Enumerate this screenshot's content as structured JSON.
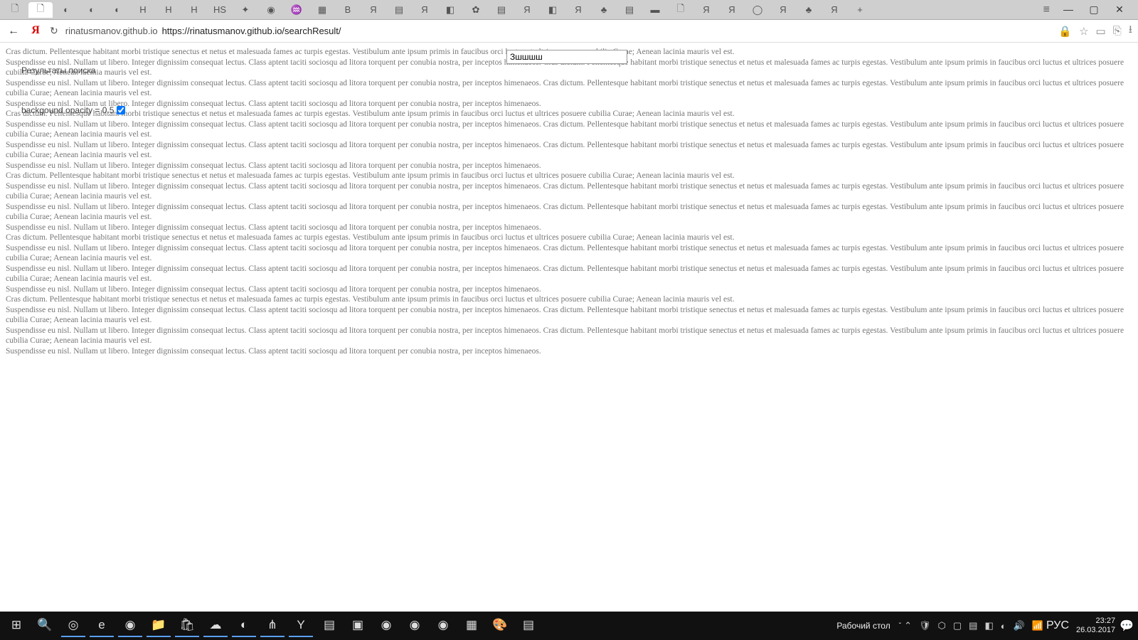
{
  "browser": {
    "url_host": "rinatusmanov.github.io",
    "url_full": "https://rinatusmanov.github.io/searchResult/",
    "tabs": [
      "🗋",
      "🗋",
      "◐",
      "◐",
      "◐",
      "H",
      "H",
      "H",
      "HS",
      "✦",
      "◉",
      "♒",
      "▦",
      "B",
      "Я",
      "▤",
      "Я",
      "◧",
      "✿",
      "▤",
      "Я",
      "◧",
      "Я",
      "♣",
      "▤",
      "▬",
      "🗋",
      "Я",
      "Я",
      "◯",
      "Я",
      "♣",
      "Я"
    ],
    "new_tab": "+",
    "menu_icon": "≡",
    "win_min": "—",
    "win_max": "▢",
    "win_close": "✕",
    "back": "←",
    "reload": "↻",
    "ya": "Я",
    "lock": "🔒",
    "star": "☆",
    "panel": "▭",
    "ribbon": "⎘",
    "download": "⭳"
  },
  "overlay": {
    "search_value": "Зшшшш",
    "results_label": "Результаты поиска",
    "opacity_label": "backgound opacity = 0.5",
    "opacity_checked": true
  },
  "taskbar": {
    "desktop_label": "Рабочий стол",
    "lang": "РУС",
    "time": "23:27",
    "date": "26.03.2017",
    "icons": [
      "⊞",
      "🔍",
      "◎",
      "e",
      "◉",
      "📁",
      "🛍",
      "☁",
      "◐",
      "⋔",
      "Y",
      "▤",
      "▣",
      "◉",
      "◉",
      "◉",
      "▦",
      "🎨",
      "▤"
    ],
    "tray": [
      "⌃",
      "🛡",
      "⬡",
      "▢",
      "▤",
      "◧",
      "◐",
      "🔊",
      "📶"
    ],
    "notif": "💬"
  },
  "lorem": {
    "a": "Cras dictum. Pellentesque habitant morbi tristique senectus et netus et malesuada fames ac turpis egestas. Vestibulum ante ipsum primis in faucibus orci luctus et ultrices posuere cubilia Curae; Aenean lacinia mauris vel est.",
    "b": "Suspendisse eu nisl. Nullam ut libero. Integer dignissim consequat lectus. Class aptent taciti sociosqu ad litora torquent per conubia nostra, per inceptos himenaeos. Cras dictum. Pellentesque habitant morbi tristique senectus et netus et malesuada fames ac turpis egestas. Vestibulum ante ipsum primis in faucibus orci luctus et ultrices posuere cubilia Curae; Aenean lacinia mauris vel est.",
    "c": "Suspendisse eu nisl. Nullam ut libero. Integer dignissim consequat lectus. Class aptent taciti sociosqu ad litora torquent per conubia nostra, per inceptos himenaeos."
  }
}
